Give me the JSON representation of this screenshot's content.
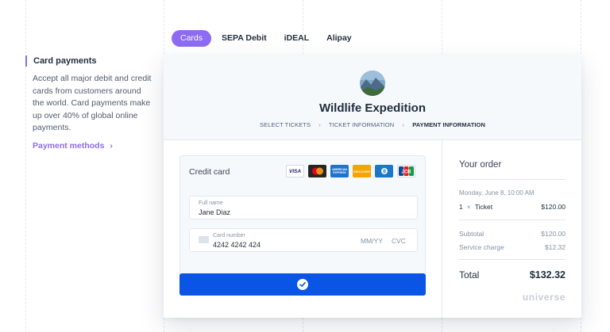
{
  "sidebar": {
    "title": "Card payments",
    "description": "Accept all major debit and credit cards from customers around the world. Card payments make up over 40% of global online payments.",
    "link_label": "Payment methods",
    "link_arrow": "›"
  },
  "tabs": [
    {
      "label": "Cards",
      "active": true
    },
    {
      "label": "SEPA Debit",
      "active": false
    },
    {
      "label": "iDEAL",
      "active": false
    },
    {
      "label": "Alipay",
      "active": false
    }
  ],
  "checkout": {
    "event_title": "Wildlife Expedition",
    "breadcrumbs": [
      "SELECT TICKETS",
      "TICKET INFORMATION",
      "PAYMENT INFORMATION"
    ],
    "breadcrumb_sep": "›",
    "credit_card_label": "Credit card",
    "card_brands": [
      "VISA",
      "mastercard",
      "AMERICAN EXPRESS",
      "DISCOVER",
      "Diners Club",
      "JCB"
    ],
    "full_name": {
      "label": "Full name",
      "value": "Jane Diaz"
    },
    "card_number": {
      "label": "Card number",
      "value": "4242 4242 424",
      "expiry_placeholder": "MM/YY",
      "cvc_placeholder": "CVC"
    }
  },
  "order": {
    "title": "Your order",
    "date": "Monday, June 8, 10:00 AM",
    "item": {
      "qty": "1",
      "times": "×",
      "name": "Ticket",
      "price": "$120.00"
    },
    "subtotal": {
      "label": "Subtotal",
      "value": "$120.00"
    },
    "service_charge": {
      "label": "Service charge",
      "value": "$12.32"
    },
    "total": {
      "label": "Total",
      "value": "$132.32"
    },
    "brand": "universe"
  },
  "colors": {
    "accent": "#8d6bf2",
    "pay_button": "#0a55e6"
  },
  "icons": [
    "chevron-right-icon",
    "credit-card-icon",
    "checkmark-icon"
  ]
}
